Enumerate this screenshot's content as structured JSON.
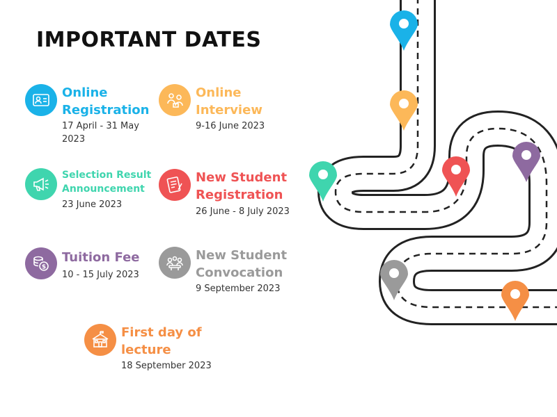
{
  "title": "IMPORTANT DATES",
  "events": [
    {
      "title_line1": "Online",
      "title_line2": "Registration",
      "date_line1": "17 April - 31 May",
      "date_line2": "2023",
      "color": "#1ab2e8",
      "icon": "id-card-icon"
    },
    {
      "title_line1": "Online",
      "title_line2": "Interview",
      "date_line1": "9-16 June 2023",
      "date_line2": "",
      "color": "#fcb859",
      "icon": "interview-icon"
    },
    {
      "title_line1": "Selection Result",
      "title_line2": "Announcement",
      "date_line1": "23 June 2023",
      "date_line2": "",
      "color": "#3fd5ae",
      "icon": "megaphone-icon"
    },
    {
      "title_line1": "New Student",
      "title_line2": "Registration",
      "date_line1": "26 June - 8 July 2023",
      "date_line2": "",
      "color": "#ef5354",
      "icon": "registration-form-icon"
    },
    {
      "title_line1": "Tuition Fee",
      "title_line2": "",
      "date_line1": "10 - 15 July 2023",
      "date_line2": "",
      "color": "#8e6aa0",
      "icon": "coins-icon"
    },
    {
      "title_line1": "New Student",
      "title_line2": "Convocation",
      "date_line1": "9 September 2023",
      "date_line2": "",
      "color": "#9a9a9a",
      "icon": "meeting-icon"
    },
    {
      "title_line1": "First day of",
      "title_line2": "lecture",
      "date_line1": "18 September 2023",
      "date_line2": "",
      "color": "#f58f45",
      "icon": "school-building-icon"
    }
  ],
  "road_colors": {
    "outer": "#222222",
    "inner": "#ffffff",
    "dash": "#222222"
  },
  "pin_colors": [
    "#1ab2e8",
    "#fcb859",
    "#3fd5ae",
    "#ef5354",
    "#8e6aa0",
    "#9a9a9a",
    "#f58f45"
  ]
}
